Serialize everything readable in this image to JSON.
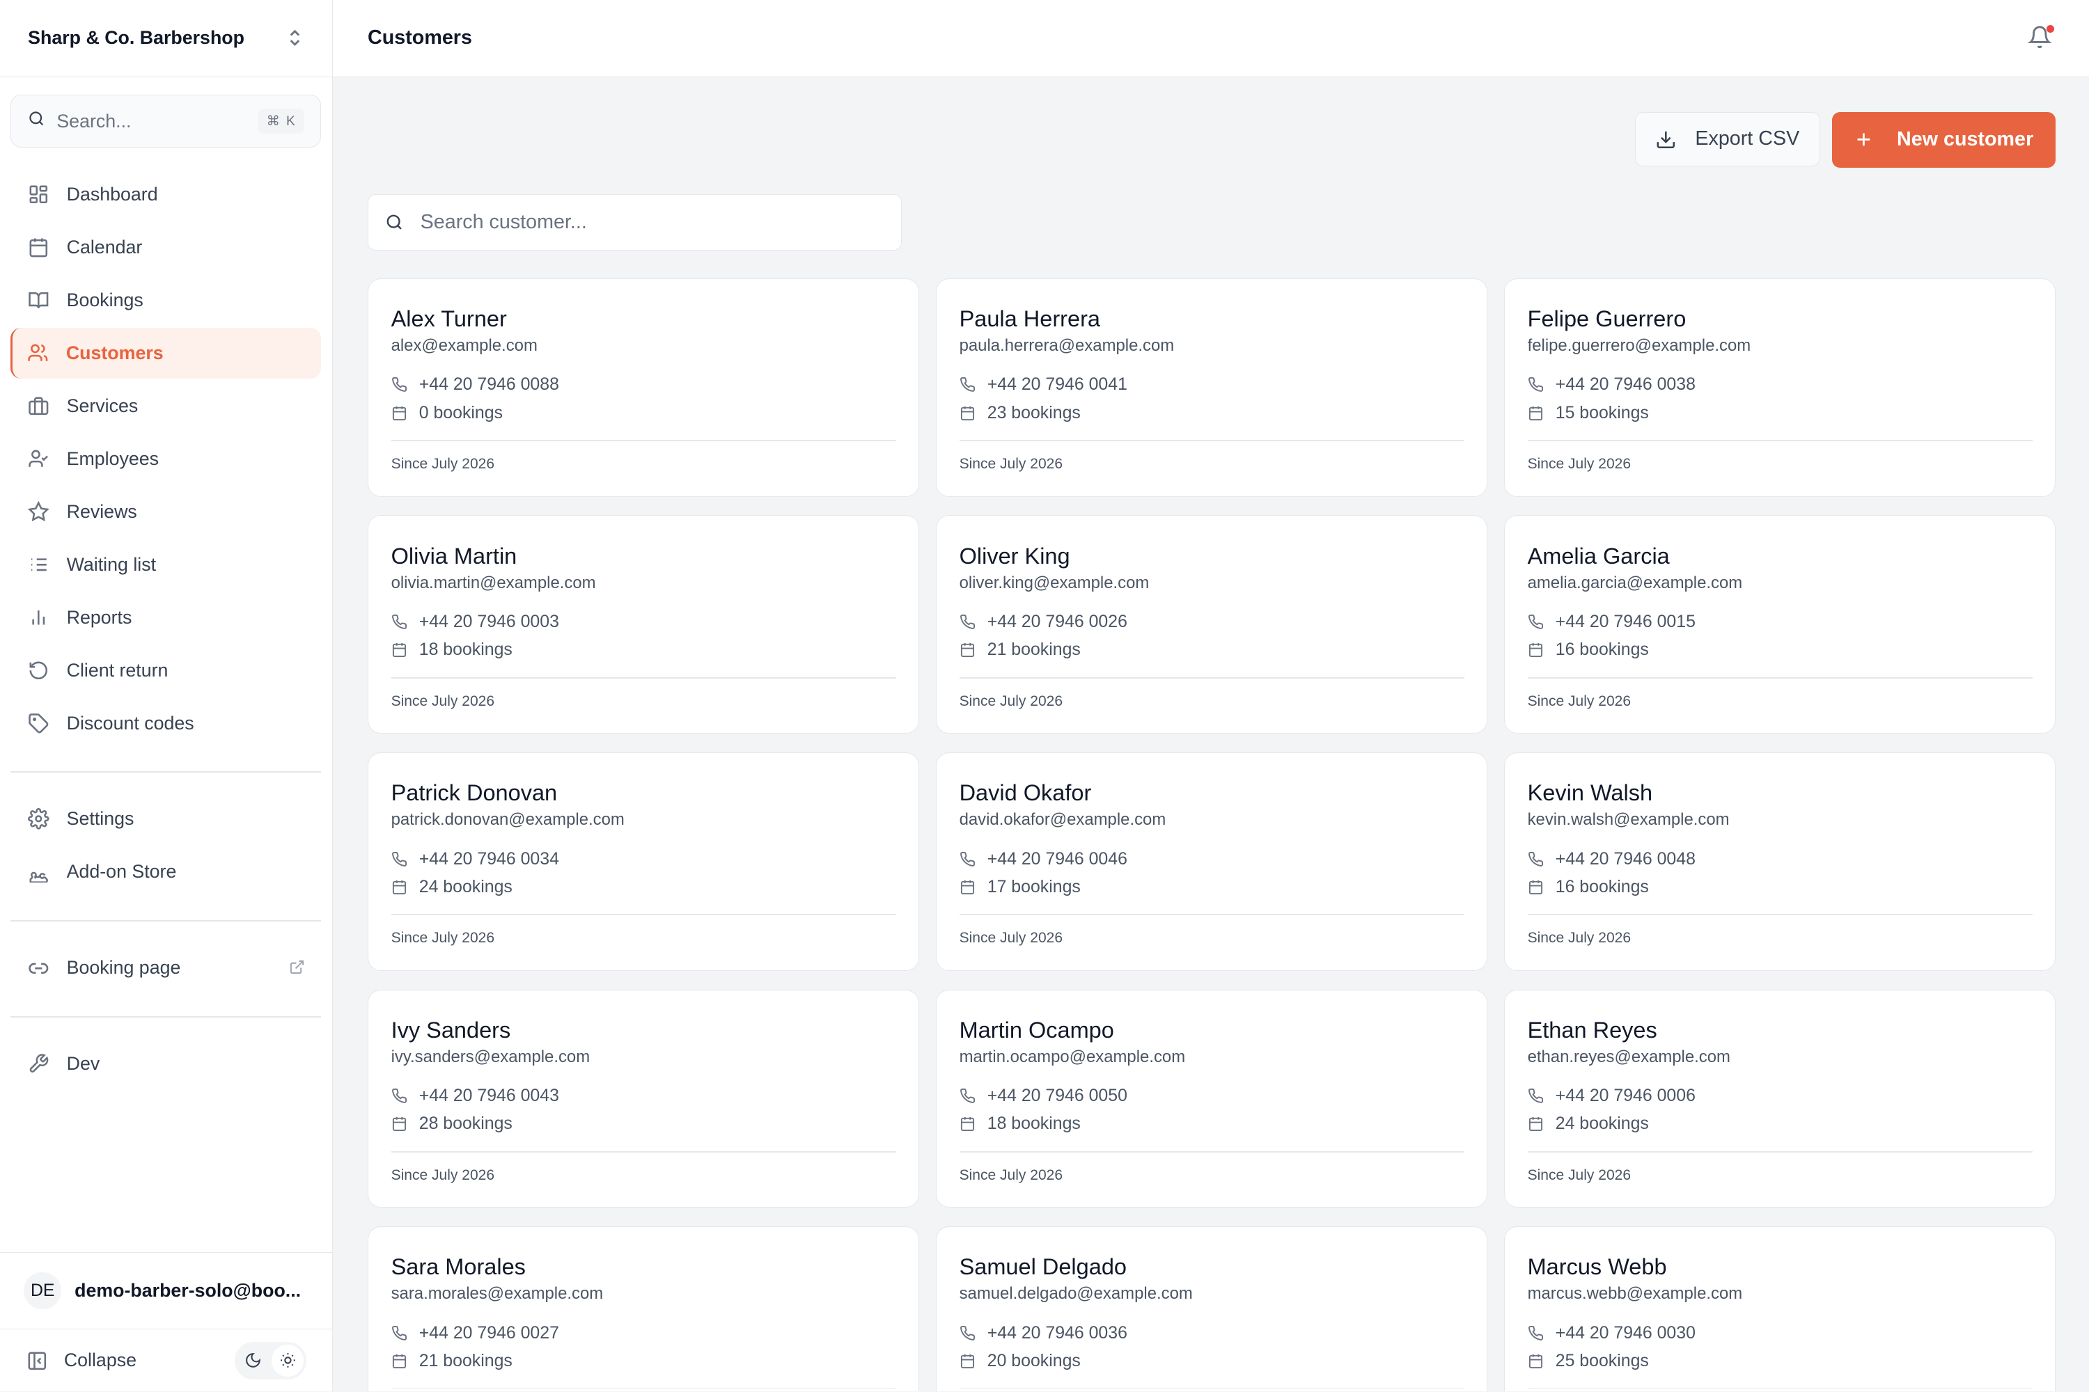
{
  "sidebar": {
    "brand": "Sharp & Co. Barbershop",
    "search_placeholder": "Search...",
    "search_shortcut": "⌘ K",
    "nav": [
      {
        "label": "Dashboard",
        "icon": "dashboard-icon"
      },
      {
        "label": "Calendar",
        "icon": "calendar-icon"
      },
      {
        "label": "Bookings",
        "icon": "book-icon"
      },
      {
        "label": "Customers",
        "icon": "users-icon",
        "active": true
      },
      {
        "label": "Services",
        "icon": "briefcase-icon"
      },
      {
        "label": "Employees",
        "icon": "user-check-icon"
      },
      {
        "label": "Reviews",
        "icon": "star-icon"
      },
      {
        "label": "Waiting list",
        "icon": "list-icon"
      },
      {
        "label": "Reports",
        "icon": "bar-chart-icon"
      },
      {
        "label": "Client return",
        "icon": "rotate-icon"
      },
      {
        "label": "Discount codes",
        "icon": "tag-icon"
      }
    ],
    "settings": "Settings",
    "addon_store": "Add-on Store",
    "booking_page": "Booking page",
    "dev": "Dev",
    "user_initials": "DE",
    "user_email": "demo-barber-solo@boo...",
    "collapse": "Collapse"
  },
  "header": {
    "title": "Customers"
  },
  "toolbar": {
    "export_label": "Export CSV",
    "new_label": "New customer"
  },
  "search": {
    "placeholder": "Search customer..."
  },
  "accent_color": "#e8633f",
  "customers": [
    {
      "name": "Alex Turner",
      "email": "alex@example.com",
      "phone": "+44 20 7946 0088",
      "bookings": "0 bookings",
      "since": "Since July 2026"
    },
    {
      "name": "Paula Herrera",
      "email": "paula.herrera@example.com",
      "phone": "+44 20 7946 0041",
      "bookings": "23 bookings",
      "since": "Since July 2026"
    },
    {
      "name": "Felipe Guerrero",
      "email": "felipe.guerrero@example.com",
      "phone": "+44 20 7946 0038",
      "bookings": "15 bookings",
      "since": "Since July 2026"
    },
    {
      "name": "Olivia Martin",
      "email": "olivia.martin@example.com",
      "phone": "+44 20 7946 0003",
      "bookings": "18 bookings",
      "since": "Since July 2026"
    },
    {
      "name": "Oliver King",
      "email": "oliver.king@example.com",
      "phone": "+44 20 7946 0026",
      "bookings": "21 bookings",
      "since": "Since July 2026"
    },
    {
      "name": "Amelia Garcia",
      "email": "amelia.garcia@example.com",
      "phone": "+44 20 7946 0015",
      "bookings": "16 bookings",
      "since": "Since July 2026"
    },
    {
      "name": "Patrick Donovan",
      "email": "patrick.donovan@example.com",
      "phone": "+44 20 7946 0034",
      "bookings": "24 bookings",
      "since": "Since July 2026"
    },
    {
      "name": "David Okafor",
      "email": "david.okafor@example.com",
      "phone": "+44 20 7946 0046",
      "bookings": "17 bookings",
      "since": "Since July 2026"
    },
    {
      "name": "Kevin Walsh",
      "email": "kevin.walsh@example.com",
      "phone": "+44 20 7946 0048",
      "bookings": "16 bookings",
      "since": "Since July 2026"
    },
    {
      "name": "Ivy Sanders",
      "email": "ivy.sanders@example.com",
      "phone": "+44 20 7946 0043",
      "bookings": "28 bookings",
      "since": "Since July 2026"
    },
    {
      "name": "Martin Ocampo",
      "email": "martin.ocampo@example.com",
      "phone": "+44 20 7946 0050",
      "bookings": "18 bookings",
      "since": "Since July 2026"
    },
    {
      "name": "Ethan Reyes",
      "email": "ethan.reyes@example.com",
      "phone": "+44 20 7946 0006",
      "bookings": "24 bookings",
      "since": "Since July 2026"
    },
    {
      "name": "Sara Morales",
      "email": "sara.morales@example.com",
      "phone": "+44 20 7946 0027",
      "bookings": "21 bookings",
      "since": ""
    },
    {
      "name": "Samuel Delgado",
      "email": "samuel.delgado@example.com",
      "phone": "+44 20 7946 0036",
      "bookings": "20 bookings",
      "since": ""
    },
    {
      "name": "Marcus Webb",
      "email": "marcus.webb@example.com",
      "phone": "+44 20 7946 0030",
      "bookings": "25 bookings",
      "since": ""
    }
  ]
}
